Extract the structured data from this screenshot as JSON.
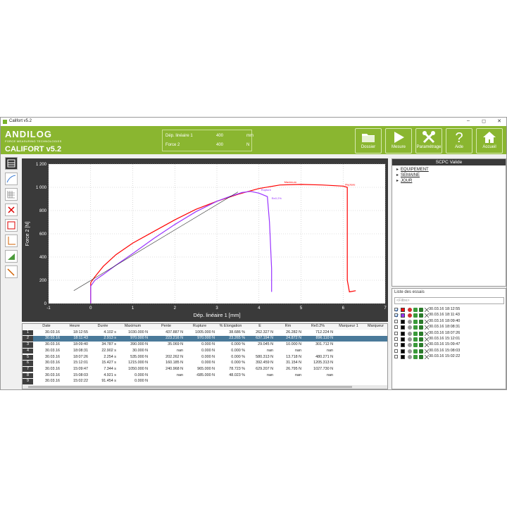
{
  "window": {
    "title": "Califort v5.2",
    "controls": [
      "–",
      "◻",
      "✕"
    ]
  },
  "header": {
    "brand": "ANDILOG",
    "tagline": "FORCE MEASURING TECHNOLOGIES",
    "app_name": "CALIFORT v5.2",
    "measures": [
      {
        "label": "Dép. linéaire 1",
        "value": "400",
        "unit": "mm"
      },
      {
        "label": "Force 2",
        "value": "400",
        "unit": "N"
      }
    ],
    "buttons": [
      {
        "label": "Dossier",
        "icon": "folder-icon"
      },
      {
        "label": "Mesure",
        "icon": "play-icon"
      },
      {
        "label": "Paramétrage",
        "icon": "tools-icon"
      },
      {
        "label": "Aide",
        "icon": "help-icon"
      },
      {
        "label": "Accueil",
        "icon": "home-icon"
      }
    ]
  },
  "left_tools": [
    "table-view-icon",
    "curve-view-icon",
    "grid-view-icon",
    "delete-curve-icon",
    "zoom-icon",
    "axis-icon",
    "report-icon",
    "wand-icon"
  ],
  "chart_data": {
    "type": "line",
    "xlabel": "Dép. linéaire 1 [mm]",
    "ylabel": "Force 2 [N]",
    "xlim": [
      -1,
      7
    ],
    "ylim": [
      0,
      1200
    ],
    "xticks": [
      "-1",
      "0",
      "1",
      "2",
      "3",
      "4",
      "5",
      "6",
      "7"
    ],
    "yticks": [
      "0",
      "200",
      "400",
      "600",
      "800",
      "1 000",
      "1 200"
    ],
    "grid": true,
    "series": [
      {
        "color": "#ff0000",
        "points": [
          [
            0,
            0
          ],
          [
            0,
            180
          ],
          [
            0.1,
            230
          ],
          [
            0.3,
            320
          ],
          [
            0.6,
            420
          ],
          [
            1,
            520
          ],
          [
            1.5,
            620
          ],
          [
            2,
            720
          ],
          [
            2.5,
            810
          ],
          [
            3,
            880
          ],
          [
            3.5,
            940
          ],
          [
            4,
            990
          ],
          [
            4.5,
            1020
          ],
          [
            5,
            1025
          ],
          [
            5.5,
            1020
          ],
          [
            6,
            1010
          ],
          [
            6.1,
            1000
          ],
          [
            6.1,
            200
          ],
          [
            6.15,
            100
          ],
          [
            6.3,
            110
          ]
        ]
      },
      {
        "color": "#9933ff",
        "points": [
          [
            0,
            0
          ],
          [
            0,
            150
          ],
          [
            0.1,
            200
          ],
          [
            0.3,
            250
          ],
          [
            0.6,
            330
          ],
          [
            1,
            430
          ],
          [
            1.5,
            560
          ],
          [
            2,
            680
          ],
          [
            2.5,
            790
          ],
          [
            3,
            880
          ],
          [
            3.3,
            920
          ],
          [
            3.6,
            955
          ],
          [
            3.8,
            965
          ],
          [
            4,
            950
          ],
          [
            4.2,
            920
          ],
          [
            4.25,
            700
          ],
          [
            4.3,
            300
          ],
          [
            4.3,
            100
          ]
        ]
      },
      {
        "color": "#222222",
        "points": [
          [
            -0.4,
            110
          ],
          [
            3.5,
            960
          ]
        ]
      }
    ],
    "annotations": [
      {
        "text": "Maximum",
        "x": 4.6,
        "y": 1030,
        "color": "#ff0000"
      },
      {
        "text": "Rupture",
        "x": 6.05,
        "y": 1010,
        "color": "#ff0000"
      },
      {
        "text": "Rupture",
        "x": 4.05,
        "y": 965,
        "color": "#9933ff"
      },
      {
        "text": "Re0.2%",
        "x": 4.3,
        "y": 890,
        "color": "#9933ff"
      }
    ]
  },
  "table": {
    "headers": [
      "",
      "Date",
      "Heure",
      "Durée",
      "Maximum",
      "Pente",
      "Rupture",
      "% Elongation",
      "E",
      "Rm",
      "Re0.2%",
      "Marqueur 1",
      "Marqueur"
    ],
    "rows": [
      [
        "1",
        "30.03.16",
        "18:12:55",
        "4.102 s",
        "1030.000 N",
        "437.887 N",
        "1005.000 N",
        "38.686 %",
        "262.327 N",
        "26.282 N",
        "712.224 N",
        "",
        ""
      ],
      [
        "2",
        "30.03.16",
        "18:11:43",
        "2.913 s",
        "970.000 N",
        "223.216 N",
        "970.000 N",
        "23.265 %",
        "637.194 N",
        "24.872 N",
        "896.110 N",
        "",
        ""
      ],
      [
        "3",
        "30.03.16",
        "18:09:40",
        "34.787 s",
        "390.000 N",
        "35.069 N",
        "0.000 N",
        "0.000 %",
        "29.045 N",
        "10.000 N",
        "301.712 N",
        "",
        ""
      ],
      [
        "4",
        "30.03.16",
        "18:08:31",
        "22.902 s",
        "30.000 N",
        "nan",
        "0.000 N",
        "0.000 %",
        "nan",
        "nan",
        "nan",
        "",
        ""
      ],
      [
        "5",
        "30.03.16",
        "18:07:26",
        "2.254 s",
        "535.000 N",
        "202.262 N",
        "0.000 N",
        "0.000 %",
        "580.313 N",
        "13.718 N",
        "480.271 N",
        "",
        ""
      ],
      [
        "6",
        "30.03.16",
        "15:12:01",
        "15.427 s",
        "1215.000 N",
        "160.185 N",
        "0.000 N",
        "0.000 %",
        "392.459 N",
        "31.154 N",
        "1205.313 N",
        "",
        ""
      ],
      [
        "7",
        "30.03.16",
        "15:09:47",
        "7.344 s",
        "1050.000 N",
        "240.968 N",
        "965.000 N",
        "78.723 %",
        "629.207 N",
        "26.795 N",
        "1027.730 N",
        "",
        ""
      ],
      [
        "8",
        "30.03.16",
        "15:08:03",
        "4.921 s",
        "0.000 N",
        "nan",
        "-685.000 N",
        "48.023 %",
        "nan",
        "nan",
        "nan",
        "",
        ""
      ],
      [
        "9",
        "30.03.16",
        "15:02:22",
        "91.454 s",
        "0.000 N",
        "",
        "",
        "",
        "",
        "",
        "",
        "",
        ""
      ]
    ],
    "selected_row": 1
  },
  "tree": {
    "title": "SCPC Valide",
    "items": [
      "EQUIPEMENT",
      "SEMAINE",
      "JOUR"
    ]
  },
  "tests": {
    "title": "Liste des essais",
    "filter_placeholder": "<Filtre>",
    "items": [
      {
        "checked": true,
        "color": "#ff0000",
        "datetime": "30.03.16 18:12:55"
      },
      {
        "checked": true,
        "color": "#9933ff",
        "datetime": "30.03.16 18:11:43"
      },
      {
        "checked": false,
        "color": "#000000",
        "datetime": "30.03.16 18:09:40"
      },
      {
        "checked": false,
        "color": "#000000",
        "datetime": "30.03.16 18:08:31"
      },
      {
        "checked": false,
        "color": "#000000",
        "datetime": "30.03.16 18:07:26"
      },
      {
        "checked": false,
        "color": "#000000",
        "datetime": "30.03.16 15:12:01"
      },
      {
        "checked": false,
        "color": "#000000",
        "datetime": "30.03.16 15:09:47"
      },
      {
        "checked": false,
        "color": "#000000",
        "datetime": "30.03.16 15:08:03"
      },
      {
        "checked": false,
        "color": "#000000",
        "datetime": "30.03.16 15:02:22"
      }
    ]
  }
}
